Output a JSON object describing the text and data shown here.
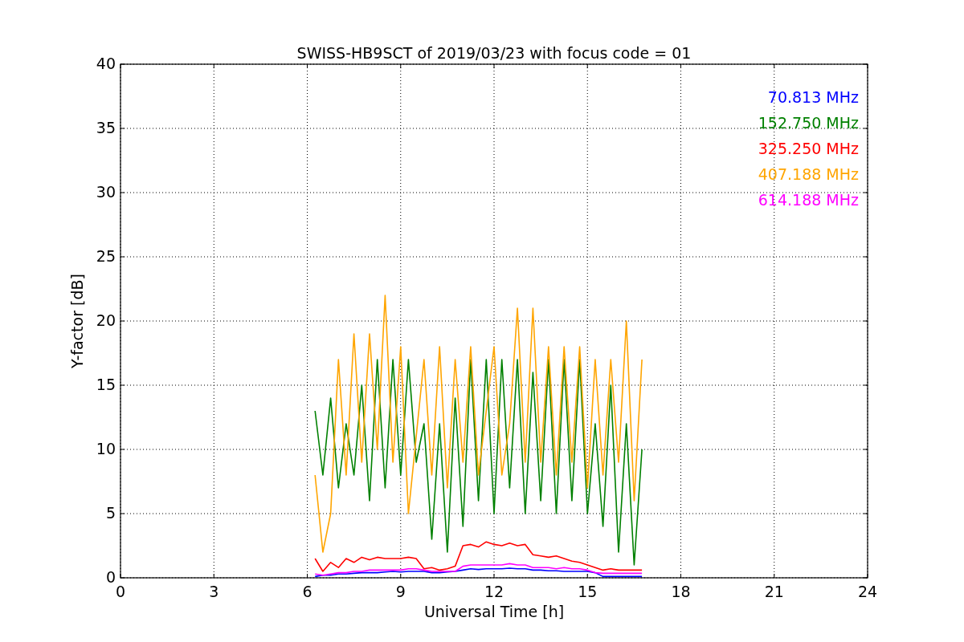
{
  "figure": {
    "chart_data": {
      "type": "line",
      "title": "SWISS-HB9SCT of 2019/03/23 with focus code = 01",
      "xlabel": "Universal Time [h]",
      "ylabel": "Y-factor [dB]",
      "x": [
        6.25,
        6.5,
        6.75,
        7.0,
        7.25,
        7.5,
        7.75,
        8.0,
        8.25,
        8.5,
        8.75,
        9.0,
        9.25,
        9.5,
        9.75,
        10.0,
        10.25,
        10.5,
        10.75,
        11.0,
        11.25,
        11.5,
        11.75,
        12.0,
        12.25,
        12.5,
        12.75,
        13.0,
        13.25,
        13.5,
        13.75,
        14.0,
        14.25,
        14.5,
        14.75,
        15.0,
        15.25,
        15.5,
        15.75,
        16.0,
        16.25,
        16.5,
        16.75
      ],
      "series": [
        {
          "name": "70.813 MHz",
          "color": "#0000ff",
          "values": [
            0.1,
            0.2,
            0.2,
            0.3,
            0.3,
            0.35,
            0.4,
            0.4,
            0.4,
            0.45,
            0.5,
            0.45,
            0.5,
            0.5,
            0.5,
            0.4,
            0.4,
            0.45,
            0.5,
            0.6,
            0.7,
            0.65,
            0.7,
            0.7,
            0.7,
            0.75,
            0.7,
            0.7,
            0.6,
            0.6,
            0.55,
            0.55,
            0.5,
            0.5,
            0.5,
            0.5,
            0.4,
            0.1,
            0.1,
            0.1,
            0.1,
            0.1,
            0.1
          ]
        },
        {
          "name": "152.750 MHz",
          "color": "#008000",
          "values": [
            13,
            8,
            14,
            7,
            12,
            8,
            15,
            6,
            17,
            7,
            17,
            8,
            17,
            9,
            12,
            3,
            12,
            2,
            14,
            4,
            17,
            6,
            17,
            5,
            17,
            7,
            17,
            5,
            16,
            6,
            17,
            5,
            17,
            6,
            17,
            5,
            12,
            4,
            15,
            2,
            12,
            1,
            10
          ]
        },
        {
          "name": "325.250 MHz",
          "color": "#ff0000",
          "values": [
            1.5,
            0.5,
            1.2,
            0.8,
            1.5,
            1.2,
            1.6,
            1.4,
            1.6,
            1.5,
            1.5,
            1.5,
            1.6,
            1.5,
            0.7,
            0.8,
            0.6,
            0.7,
            0.9,
            2.5,
            2.6,
            2.4,
            2.8,
            2.6,
            2.5,
            2.7,
            2.5,
            2.6,
            1.8,
            1.7,
            1.6,
            1.7,
            1.5,
            1.3,
            1.2,
            1.0,
            0.8,
            0.6,
            0.7,
            0.6,
            0.6,
            0.6,
            0.6
          ]
        },
        {
          "name": "407.188 MHz",
          "color": "#ffa500",
          "values": [
            8,
            2,
            5,
            17,
            8,
            19,
            9,
            19,
            10,
            22,
            9,
            18,
            5,
            11,
            17,
            8,
            18,
            7,
            17,
            9,
            18,
            8,
            13,
            18,
            8,
            12,
            21,
            9,
            21,
            9,
            18,
            8,
            18,
            9,
            18,
            7,
            17,
            8,
            17,
            9,
            20,
            6,
            17
          ]
        },
        {
          "name": "614.188 MHz",
          "color": "#ff00ff",
          "values": [
            0.3,
            0.2,
            0.3,
            0.4,
            0.4,
            0.5,
            0.5,
            0.6,
            0.6,
            0.6,
            0.6,
            0.6,
            0.7,
            0.7,
            0.6,
            0.5,
            0.5,
            0.5,
            0.5,
            0.9,
            1.0,
            1.0,
            1.0,
            1.0,
            1.0,
            1.1,
            1.0,
            1.0,
            0.8,
            0.8,
            0.8,
            0.7,
            0.8,
            0.7,
            0.7,
            0.6,
            0.4,
            0.35,
            0.35,
            0.35,
            0.35,
            0.35,
            0.35
          ]
        }
      ],
      "grid": true,
      "xlim": [
        0,
        24
      ],
      "ylim": [
        0,
        40
      ],
      "xticks": [
        0,
        3,
        6,
        9,
        12,
        15,
        18,
        21,
        24
      ],
      "yticks": [
        0,
        5,
        10,
        15,
        20,
        25,
        30,
        35,
        40
      ]
    }
  }
}
